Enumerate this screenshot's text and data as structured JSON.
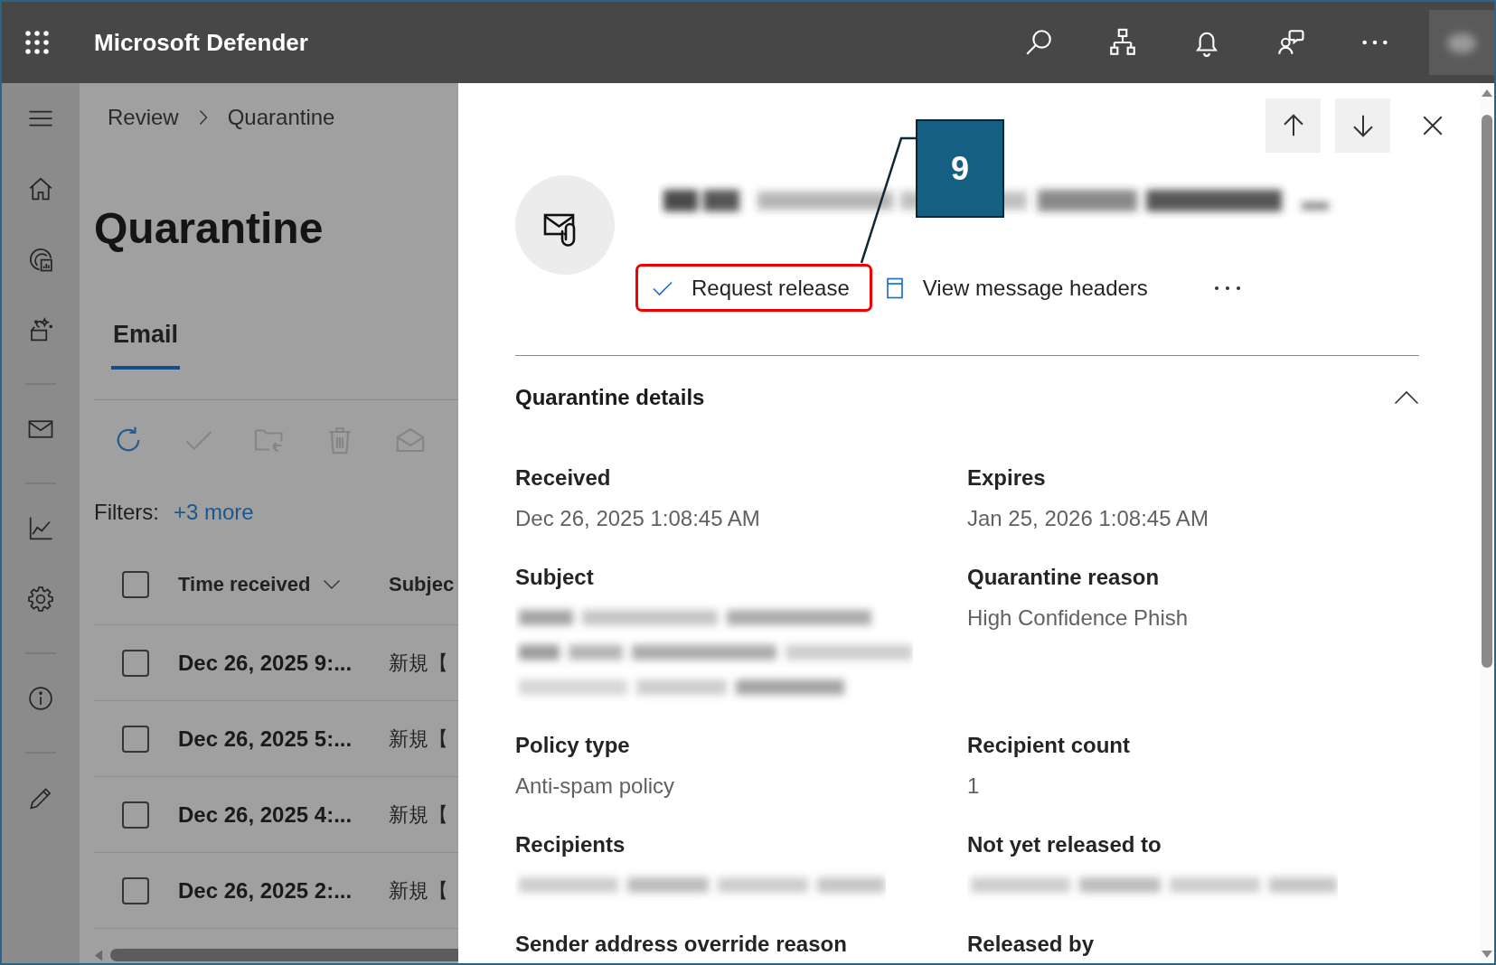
{
  "app_bar": {
    "title": "Microsoft Defender"
  },
  "breadcrumb": [
    "Review",
    "Quarantine"
  ],
  "page_title": "Quarantine",
  "tabs": [
    {
      "label": "Email",
      "selected": true
    }
  ],
  "toolbar": [
    {
      "disabled": false
    },
    {
      "disabled": true
    },
    {
      "disabled": true
    },
    {
      "disabled": true
    },
    {
      "disabled": true
    }
  ],
  "filters": {
    "label": "Filters:",
    "link": "+3 more"
  },
  "table": {
    "header_checked": false,
    "columns": [
      {
        "label": "Time received",
        "sorted": true
      },
      {
        "label": "Subjec",
        "sorted": false
      }
    ],
    "rows": [
      {
        "checked": false,
        "time": "Dec 26, 2025 9:...",
        "subject": "新規【"
      },
      {
        "checked": false,
        "time": "Dec 26, 2025 5:...",
        "subject": "新規【"
      },
      {
        "checked": false,
        "time": "Dec 26, 2025 4:...",
        "subject": "新規【"
      },
      {
        "checked": false,
        "time": "Dec 26, 2025 2:...",
        "subject": "新規【"
      }
    ]
  },
  "details_panel": {
    "title_blurred": true,
    "actions": [
      {
        "label": "Request release",
        "highlighted": true
      },
      {
        "label": "View message headers",
        "highlighted": false
      }
    ],
    "section": {
      "title": "Quarantine details",
      "expanded": true
    },
    "fields": [
      {
        "kind": "text",
        "label": "Received",
        "value": "Dec 26, 2025 1:08:45 AM"
      },
      {
        "kind": "text",
        "label": "Expires",
        "value": "Jan 25, 2026 1:08:45 AM"
      },
      {
        "kind": "blurred_paragraph",
        "label": "Subject"
      },
      {
        "kind": "text",
        "label": "Quarantine reason",
        "value": "High Confidence Phish"
      },
      {
        "kind": "text",
        "label": "Policy type",
        "value": "Anti-spam policy"
      },
      {
        "kind": "text",
        "label": "Recipient count",
        "value": "1"
      },
      {
        "kind": "blurred_line",
        "label": "Recipients"
      },
      {
        "kind": "blurred_line",
        "label": "Not yet released to"
      },
      {
        "kind": "label",
        "label": "Sender address override reason"
      },
      {
        "kind": "label",
        "label": "Released by"
      }
    ]
  },
  "callout": {
    "label": "9"
  }
}
